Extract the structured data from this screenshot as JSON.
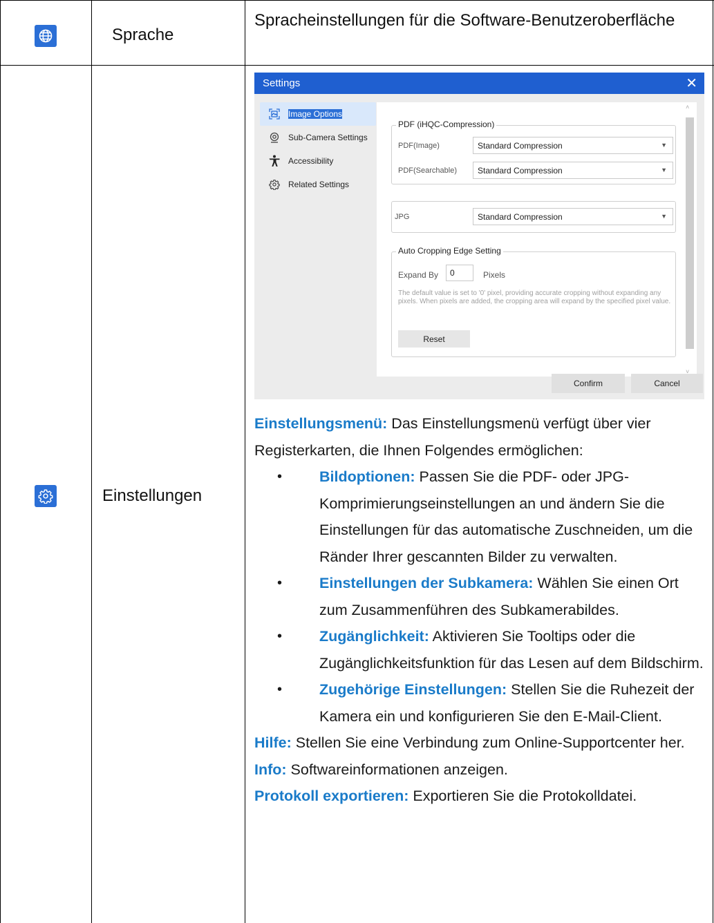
{
  "rows": [
    {
      "icon": "globe-icon",
      "label": "Sprache",
      "description": "Spracheinstellungen für die Software-Benutzeroberfläche"
    },
    {
      "icon": "gear-icon",
      "label": "Einstellungen"
    }
  ],
  "settings_dialog": {
    "title": "Settings",
    "close_glyph": "✕",
    "sidebar": [
      {
        "label": "Image Options",
        "icon": "image-icon",
        "active": true
      },
      {
        "label": "Sub-Camera Settings",
        "icon": "camera-icon",
        "active": false
      },
      {
        "label": "Accessibility",
        "icon": "accessibility-icon",
        "active": false
      },
      {
        "label": "Related Settings",
        "icon": "gear-icon",
        "active": false
      }
    ],
    "pdf_group": {
      "title": "PDF (iHQC-Compression)",
      "image_label": "PDF(Image)",
      "image_value": "Standard Compression",
      "searchable_label": "PDF(Searchable)",
      "searchable_value": "Standard Compression"
    },
    "jpg": {
      "label": "JPG",
      "value": "Standard Compression"
    },
    "crop_group": {
      "title": "Auto Cropping Edge Setting",
      "expand_label": "Expand By",
      "expand_value": "0",
      "unit": "Pixels",
      "note": "The default value is set to '0' pixel, providing accurate cropping without expanding any pixels. When pixels are added, the cropping area will expand by the specified pixel value.",
      "reset_label": "Reset"
    },
    "confirm_label": "Confirm",
    "cancel_label": "Cancel"
  },
  "settings_description": {
    "intro_key": "Einstellungsmenü:",
    "intro_text": " Das Einstellungsmenü verfügt über vier Registerkarten, die Ihnen Folgendes ermöglichen:",
    "bullets": [
      {
        "key": "Bildoptionen:",
        "text": " Passen Sie die PDF- oder JPG-Komprimierungseinstellungen an und ändern Sie die Einstellungen für das automatische Zuschneiden, um die Ränder Ihrer gescannten Bilder zu verwalten."
      },
      {
        "key": "Einstellungen der Subkamera:",
        "text": " Wählen Sie einen Ort zum Zusammenführen des Subkamerabildes."
      },
      {
        "key": "Zugänglichkeit:",
        "text": " Aktivieren Sie Tooltips oder die Zugänglichkeitsfunktion für das Lesen auf dem Bildschirm."
      },
      {
        "key": "Zugehörige Einstellungen:",
        "text": " Stellen Sie die Ruhezeit der Kamera ein und konfigurieren Sie den E-Mail-Client."
      }
    ],
    "bullet_glyph": "•",
    "extras": [
      {
        "key": "Hilfe:",
        "text": " Stellen Sie eine Verbindung zum Online-Supportcenter her."
      },
      {
        "key": "Info:",
        "text": " Softwareinformationen anzeigen."
      },
      {
        "key": "Protokoll exportieren:",
        "text": " Exportieren Sie die Protokolldatei."
      }
    ]
  },
  "colors": {
    "keyword": "#1a7bc9",
    "icon_bg": "#2b6fd6",
    "dialog_title_bg": "#1f5fd0"
  }
}
